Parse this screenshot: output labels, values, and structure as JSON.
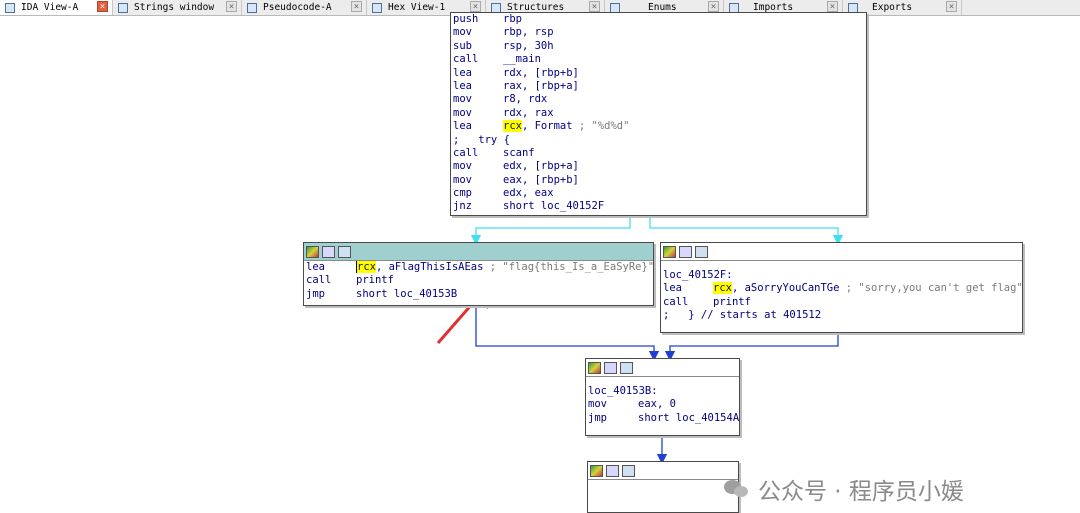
{
  "tabs": [
    {
      "label": "IDA View-A",
      "icon": "ida-view-icon",
      "active": true
    },
    {
      "label": "Strings window",
      "icon": "strings-icon"
    },
    {
      "label": "Pseudocode-A",
      "icon": "pseudocode-icon"
    },
    {
      "label": "Hex View-1",
      "icon": "hex-icon"
    },
    {
      "label": "Structures",
      "icon": "structures-icon"
    },
    {
      "label": "Enums",
      "icon": "enums-icon"
    },
    {
      "label": "Imports",
      "icon": "imports-icon"
    },
    {
      "label": "Exports",
      "icon": "exports-icon"
    }
  ],
  "tab_close_glyph": "×",
  "blocks": {
    "main": {
      "lines": [
        {
          "mn": "push",
          "op": "rbp"
        },
        {
          "mn": "mov",
          "op": "rbp, rsp"
        },
        {
          "mn": "sub",
          "op": "rsp, 30h"
        },
        {
          "mn": "call",
          "op": "__main"
        },
        {
          "mn": "lea",
          "op": "rdx, [rbp+b]"
        },
        {
          "mn": "lea",
          "op": "rax, [rbp+a]"
        },
        {
          "mn": "mov",
          "op": "r8, rdx"
        },
        {
          "mn": "mov",
          "op": "rdx, rax"
        },
        {
          "mn": "lea",
          "reg": "rcx",
          "op": ", Format",
          "comment": "; \"%d%d\""
        },
        {
          "raw": ";   try {"
        },
        {
          "mn": "call",
          "op": "scanf"
        },
        {
          "mn": "mov",
          "op": "edx, [rbp+a]"
        },
        {
          "mn": "mov",
          "op": "eax, [rbp+b]"
        },
        {
          "mn": "cmp",
          "op": "edx, eax"
        },
        {
          "mn": "jnz",
          "op": "short loc_40152F"
        }
      ]
    },
    "flag": {
      "lines": [
        {
          "mn": "lea",
          "reg": "rcx",
          "op": ", aFlagThisIsAEas",
          "comment": "; \"flag{this_Is_a_EaSyRe}\""
        },
        {
          "mn": "call",
          "op": "printf"
        },
        {
          "mn": "jmp",
          "op": "short loc_40153B"
        }
      ]
    },
    "sorry": {
      "label": "loc_40152F:",
      "lines": [
        {
          "mn": "lea",
          "reg": "rcx",
          "op": ", aSorryYouCanTGe",
          "comment": "; \"sorry,you can't get flag\""
        },
        {
          "mn": "call",
          "op": "printf"
        },
        {
          "raw": ";   } // starts at 401512"
        }
      ]
    },
    "join": {
      "label": "loc_40153B:",
      "lines": [
        {
          "mn": "mov",
          "op": "eax, 0"
        },
        {
          "mn": "jmp",
          "op": "short loc_40154A"
        }
      ]
    },
    "tail": {
      "lines": []
    }
  },
  "watermark": {
    "text": "公众号 · 程序员小媛"
  },
  "colors": {
    "selected_header": "#9fcfcf",
    "edge_cyan": "#40e0f0",
    "edge_blue": "#2040d0",
    "arrow_red": "#e03030",
    "highlight": "#ffff00"
  }
}
